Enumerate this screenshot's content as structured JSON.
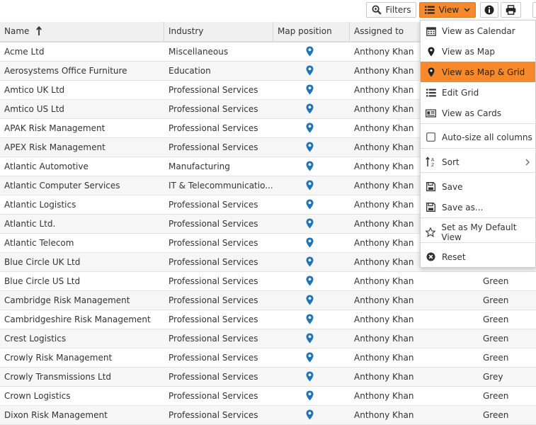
{
  "toolbar": {
    "filters_label": "Filters",
    "view_label": "View",
    "icons": {
      "filters": "search-icon",
      "view": "list-icon",
      "info": "info-icon",
      "print": "print-icon"
    }
  },
  "grid": {
    "columns": [
      "Name",
      "Industry",
      "Map position",
      "Assigned to",
      ""
    ],
    "sort_column": "Name",
    "sort_direction": "ascending",
    "rows": [
      {
        "name": "Acme Ltd",
        "industry": "Miscellaneous",
        "assigned": "Anthony Khan",
        "colour": ""
      },
      {
        "name": "Aerosystems Office Furniture",
        "industry": "Education",
        "assigned": "Anthony Khan",
        "colour": ""
      },
      {
        "name": "Amtico UK Ltd",
        "industry": "Professional Services",
        "assigned": "Anthony Khan",
        "colour": ""
      },
      {
        "name": "Amtico US Ltd",
        "industry": "Professional Services",
        "assigned": "Anthony Khan",
        "colour": ""
      },
      {
        "name": "APAK Risk Management",
        "industry": "Professional Services",
        "assigned": "Anthony Khan",
        "colour": ""
      },
      {
        "name": "APEX Risk Management",
        "industry": "Professional Services",
        "assigned": "Anthony Khan",
        "colour": ""
      },
      {
        "name": "Atlantic Automotive",
        "industry": "Manufacturing",
        "assigned": "Anthony Khan",
        "colour": ""
      },
      {
        "name": "Atlantic Computer Services",
        "industry": "IT & Telecommunicatio...",
        "assigned": "Anthony Khan",
        "colour": ""
      },
      {
        "name": "Atlantic Logistics",
        "industry": "Professional Services",
        "assigned": "Anthony Khan",
        "colour": ""
      },
      {
        "name": "Atlantic Ltd.",
        "industry": "Professional Services",
        "assigned": "Anthony Khan",
        "colour": ""
      },
      {
        "name": "Atlantic Telecom",
        "industry": "Professional Services",
        "assigned": "Anthony Khan",
        "colour": ""
      },
      {
        "name": "Blue Circle UK Ltd",
        "industry": "Professional Services",
        "assigned": "Anthony Khan",
        "colour": ""
      },
      {
        "name": "Blue Circle US Ltd",
        "industry": "Professional Services",
        "assigned": "Anthony Khan",
        "colour": "Green"
      },
      {
        "name": "Cambridge Risk Management",
        "industry": "Professional Services",
        "assigned": "Anthony Khan",
        "colour": "Green"
      },
      {
        "name": "Cambridgeshire Risk Management",
        "industry": "Professional Services",
        "assigned": "Anthony Khan",
        "colour": "Green"
      },
      {
        "name": "Crest Logistics",
        "industry": "Professional Services",
        "assigned": "Anthony Khan",
        "colour": "Green"
      },
      {
        "name": "Crowly Risk Management",
        "industry": "Professional Services",
        "assigned": "Anthony Khan",
        "colour": "Green"
      },
      {
        "name": "Crowly Transmissions Ltd",
        "industry": "Professional Services",
        "assigned": "Anthony Khan",
        "colour": "Grey"
      },
      {
        "name": "Crown Logistics",
        "industry": "Professional Services",
        "assigned": "Anthony Khan",
        "colour": "Green"
      },
      {
        "name": "Dixon Risk Management",
        "industry": "Professional Services",
        "assigned": "Anthony Khan",
        "colour": "Green"
      }
    ]
  },
  "view_menu": {
    "items": [
      {
        "label": "View as Calendar",
        "icon": "calendar-icon",
        "active": false
      },
      {
        "label": "View as Map",
        "icon": "map-pin-icon",
        "active": false
      },
      {
        "label": "View as Map & Grid",
        "icon": "map-pin-icon",
        "active": true
      },
      {
        "label": "Edit Grid",
        "icon": "list-icon",
        "active": false
      },
      {
        "label": "View as Cards",
        "icon": "card-icon",
        "active": false
      },
      {
        "label": "Auto-size all columns",
        "icon": "checkbox-icon",
        "active": false
      },
      {
        "label": "Sort",
        "icon": "sort-az-icon",
        "active": false,
        "submenu": true
      },
      {
        "label": "Save",
        "icon": "save-icon",
        "active": false
      },
      {
        "label": "Save as...",
        "icon": "save-as-icon",
        "active": false
      },
      {
        "label": "Set as My Default View",
        "icon": "star-icon",
        "active": false
      },
      {
        "label": "Reset",
        "icon": "reset-icon",
        "active": false
      }
    ]
  },
  "colors": {
    "accent": "#f5892b",
    "pin": "#1f73b7",
    "header_bg": "#f0f0f0",
    "alt_row": "#f6f6f6"
  }
}
